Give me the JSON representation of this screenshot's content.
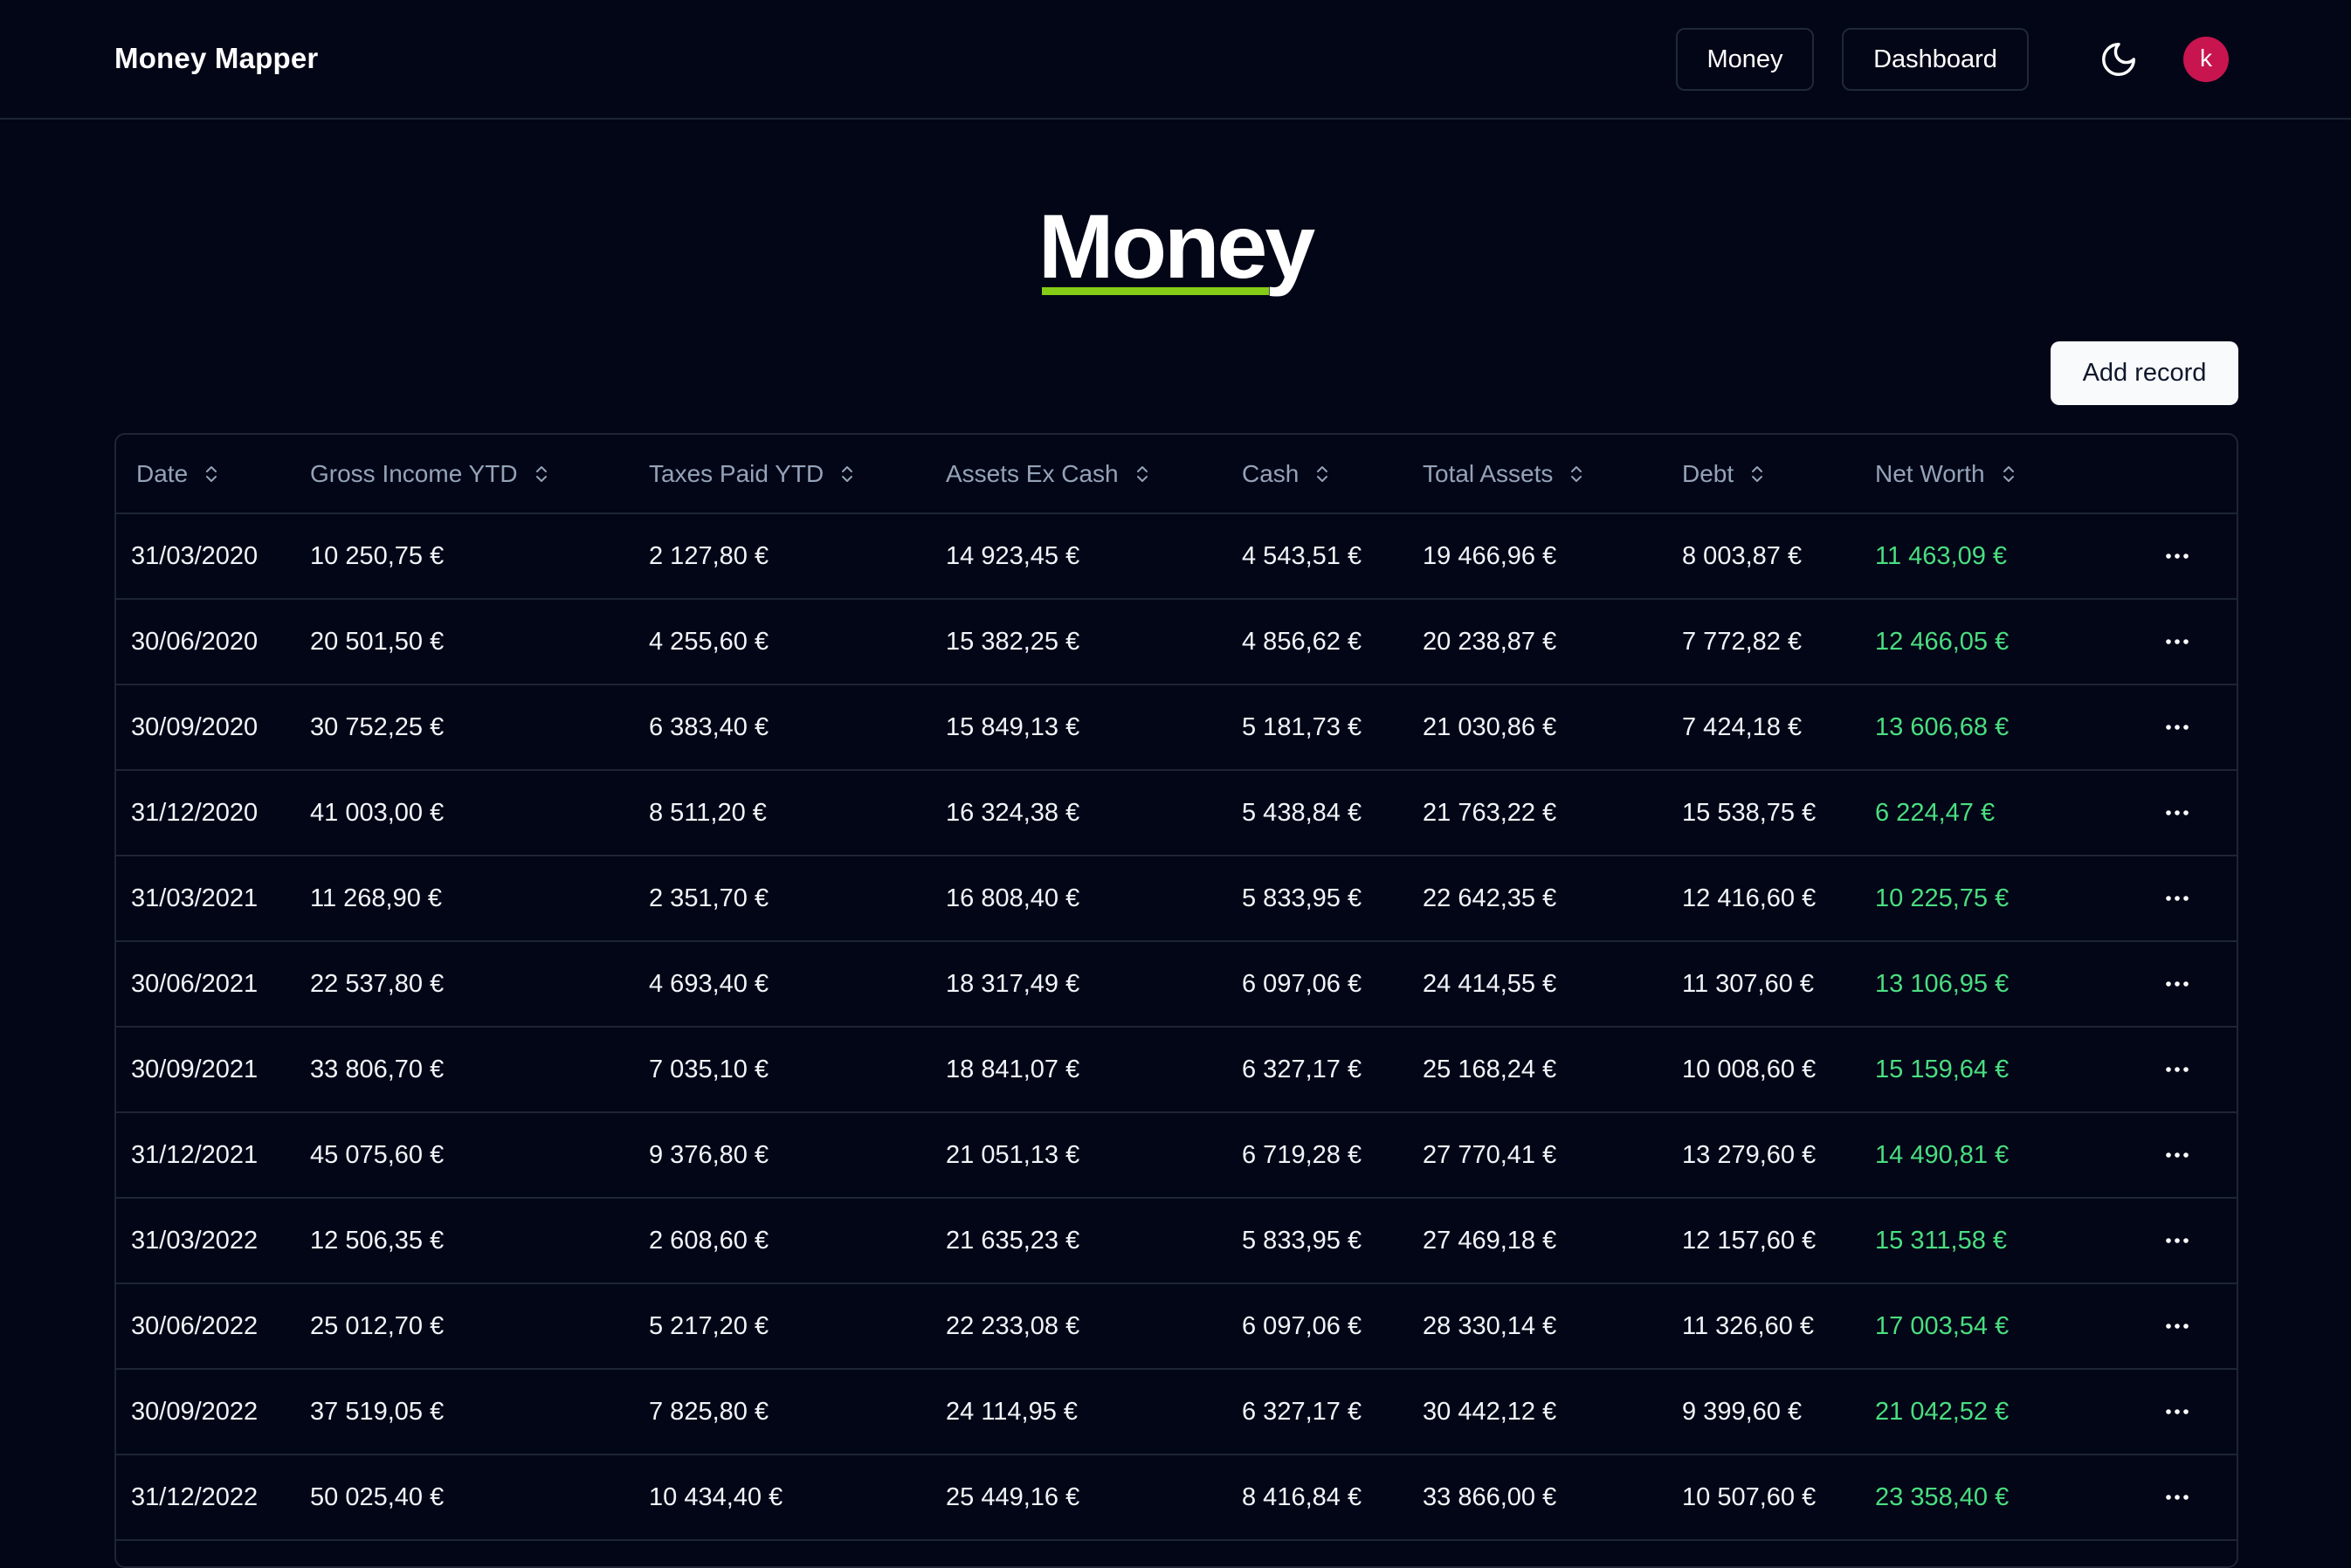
{
  "app": {
    "title": "Money Mapper"
  },
  "nav": {
    "money_label": "Money",
    "dashboard_label": "Dashboard",
    "theme_icon": "moon-icon",
    "avatar_initial": "k",
    "avatar_color": "#c8154f"
  },
  "page": {
    "title": "Money",
    "title_underline_color": "#84cc16",
    "add_record_label": "Add record"
  },
  "table": {
    "columns": [
      "Date",
      "Gross Income YTD",
      "Taxes Paid YTD",
      "Assets Ex Cash",
      "Cash",
      "Total Assets",
      "Debt",
      "Net Worth"
    ],
    "net_worth_color": "#4ade80",
    "rows": [
      [
        "31/03/2020",
        "10 250,75 €",
        "2 127,80 €",
        "14 923,45 €",
        "4 543,51 €",
        "19 466,96 €",
        "8 003,87 €",
        "11 463,09 €"
      ],
      [
        "30/06/2020",
        "20 501,50 €",
        "4 255,60 €",
        "15 382,25 €",
        "4 856,62 €",
        "20 238,87 €",
        "7 772,82 €",
        "12 466,05 €"
      ],
      [
        "30/09/2020",
        "30 752,25 €",
        "6 383,40 €",
        "15 849,13 €",
        "5 181,73 €",
        "21 030,86 €",
        "7 424,18 €",
        "13 606,68 €"
      ],
      [
        "31/12/2020",
        "41 003,00 €",
        "8 511,20 €",
        "16 324,38 €",
        "5 438,84 €",
        "21 763,22 €",
        "15 538,75 €",
        "6 224,47 €"
      ],
      [
        "31/03/2021",
        "11 268,90 €",
        "2 351,70 €",
        "16 808,40 €",
        "5 833,95 €",
        "22 642,35 €",
        "12 416,60 €",
        "10 225,75 €"
      ],
      [
        "30/06/2021",
        "22 537,80 €",
        "4 693,40 €",
        "18 317,49 €",
        "6 097,06 €",
        "24 414,55 €",
        "11 307,60 €",
        "13 106,95 €"
      ],
      [
        "30/09/2021",
        "33 806,70 €",
        "7 035,10 €",
        "18 841,07 €",
        "6 327,17 €",
        "25 168,24 €",
        "10 008,60 €",
        "15 159,64 €"
      ],
      [
        "31/12/2021",
        "45 075,60 €",
        "9 376,80 €",
        "21 051,13 €",
        "6 719,28 €",
        "27 770,41 €",
        "13 279,60 €",
        "14 490,81 €"
      ],
      [
        "31/03/2022",
        "12 506,35 €",
        "2 608,60 €",
        "21 635,23 €",
        "5 833,95 €",
        "27 469,18 €",
        "12 157,60 €",
        "15 311,58 €"
      ],
      [
        "30/06/2022",
        "25 012,70 €",
        "5 217,20 €",
        "22 233,08 €",
        "6 097,06 €",
        "28 330,14 €",
        "11 326,60 €",
        "17 003,54 €"
      ],
      [
        "30/09/2022",
        "37 519,05 €",
        "7 825,80 €",
        "24 114,95 €",
        "6 327,17 €",
        "30 442,12 €",
        "9 399,60 €",
        "21 042,52 €"
      ],
      [
        "31/12/2022",
        "50 025,40 €",
        "10 434,40 €",
        "25 449,16 €",
        "8 416,84 €",
        "33 866,00 €",
        "10 507,60 €",
        "23 358,40 €"
      ]
    ]
  }
}
